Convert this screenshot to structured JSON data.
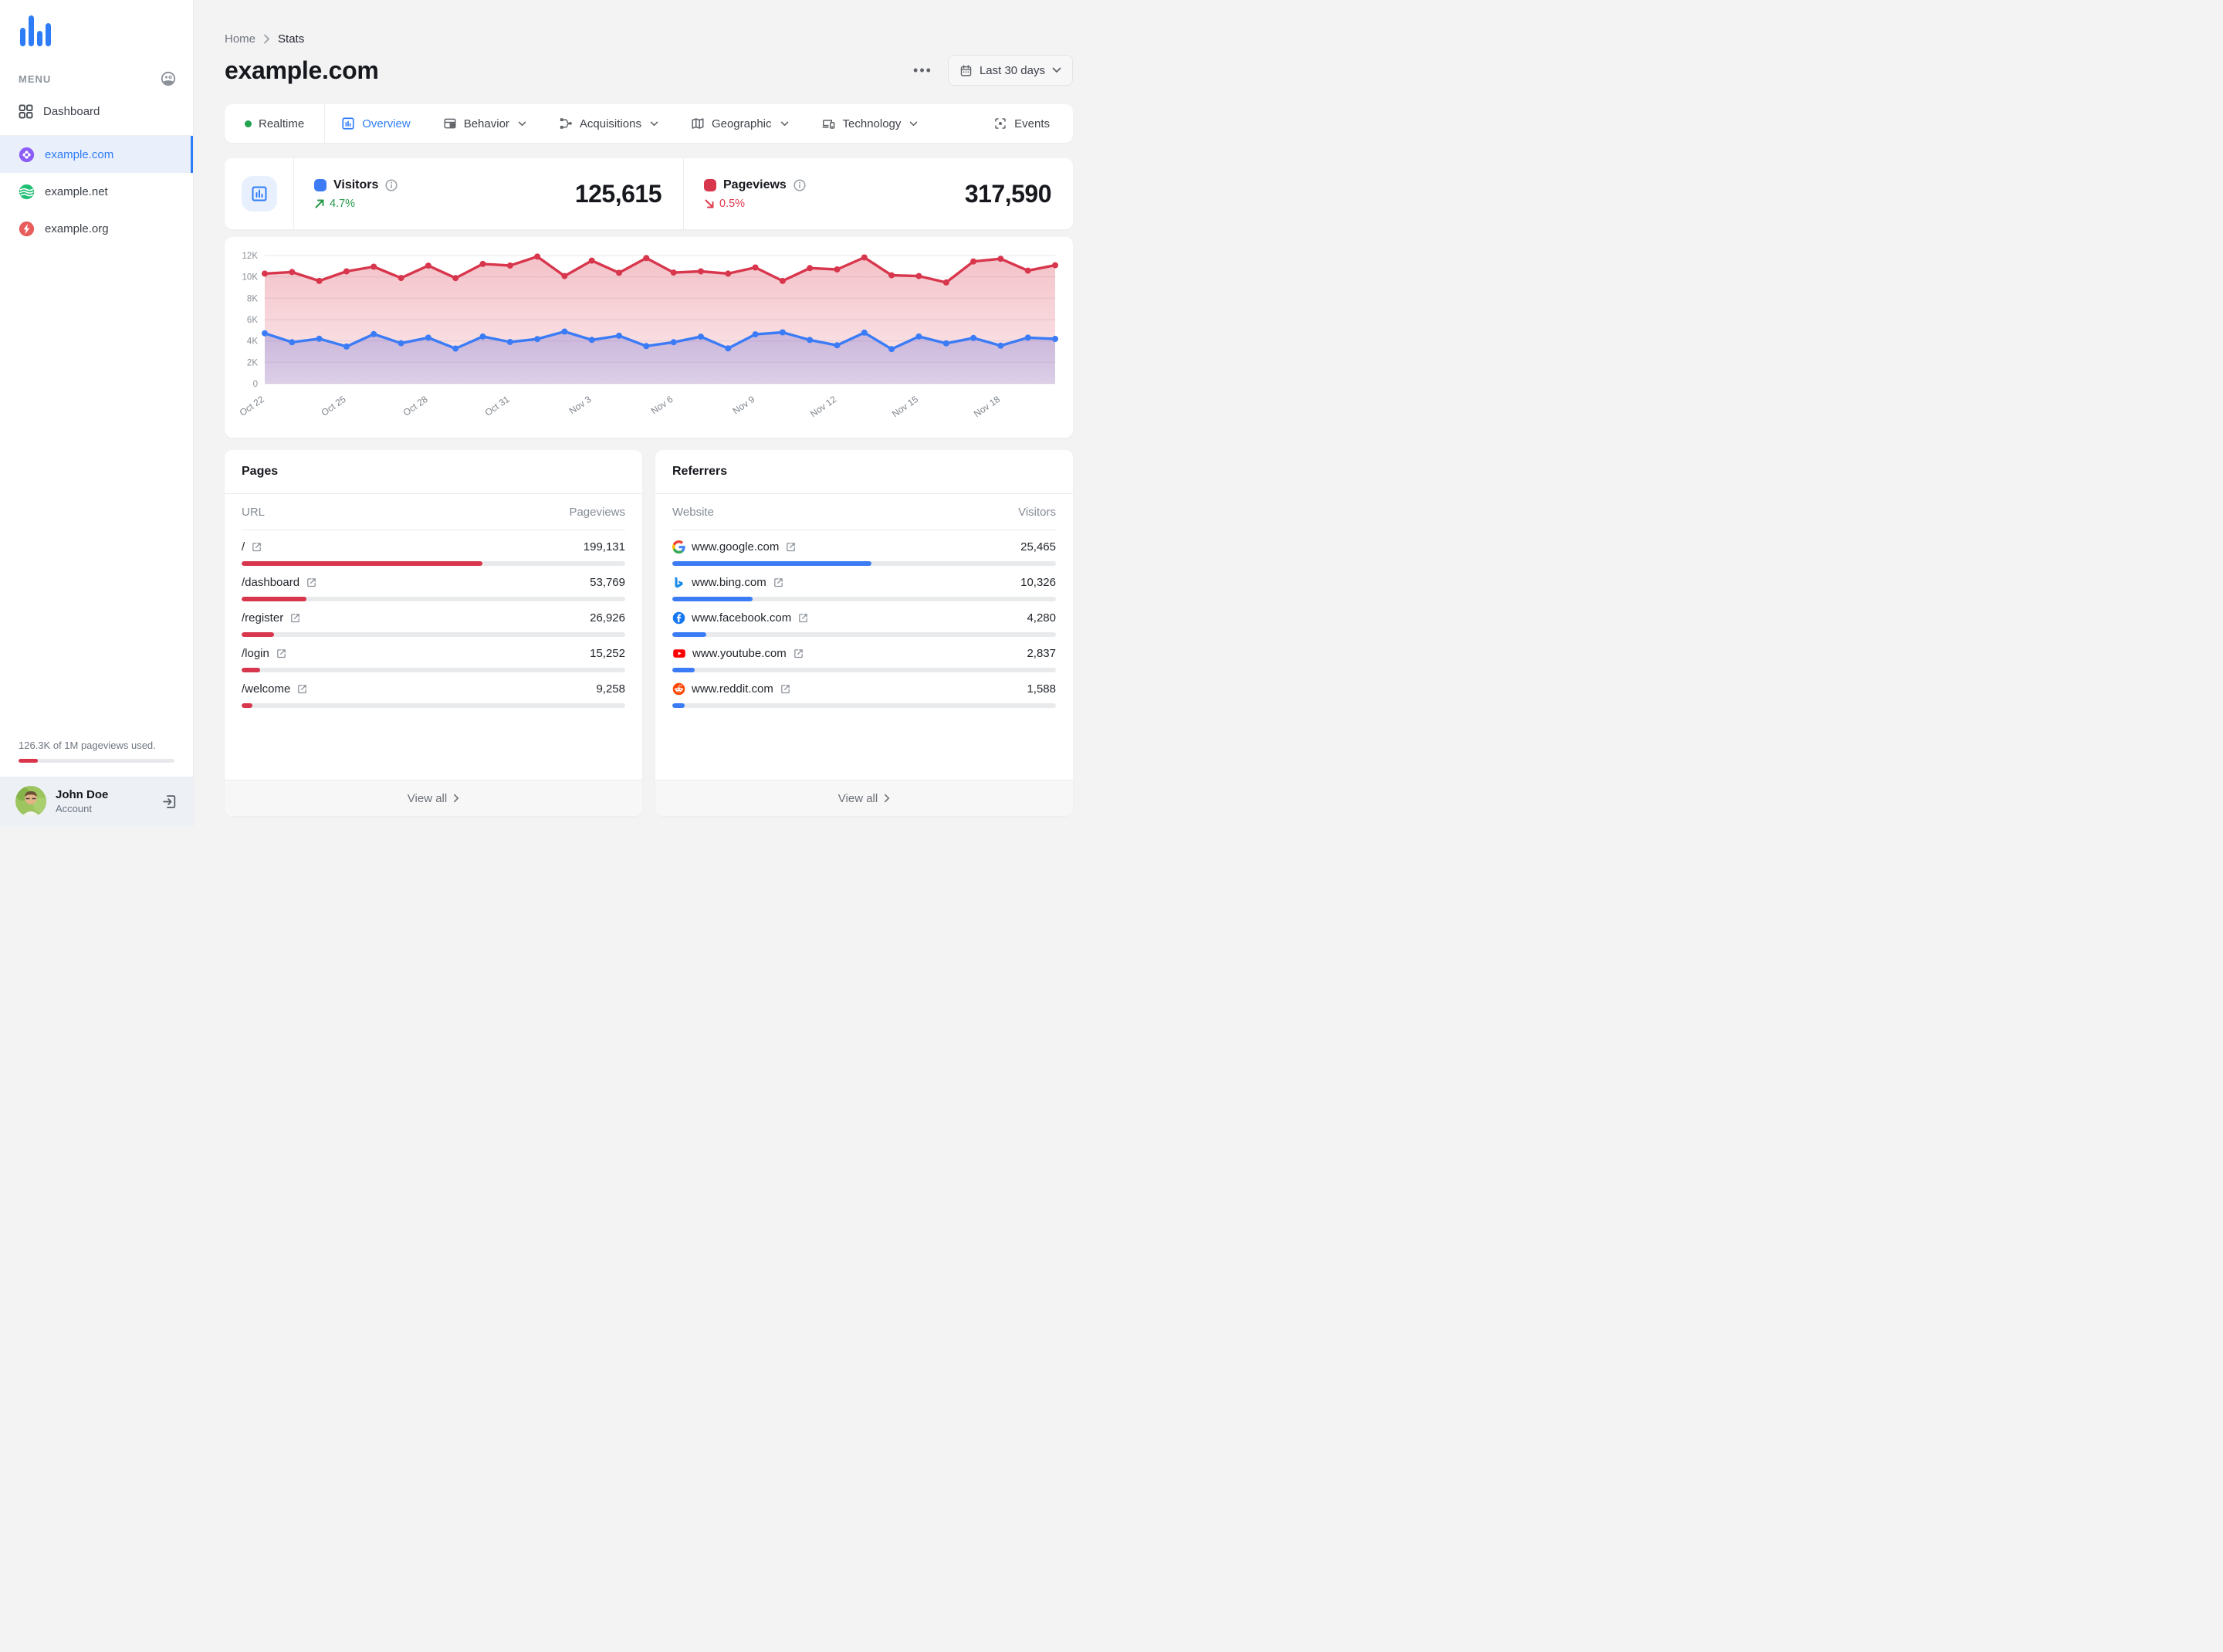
{
  "sidebar": {
    "menu_label": "MENU",
    "dashboard_label": "Dashboard",
    "sites": [
      {
        "name": "example.com",
        "icon": "clover",
        "color": "#8b5cf6",
        "active": true
      },
      {
        "name": "example.net",
        "icon": "waves",
        "color": "#1fbf75",
        "active": false
      },
      {
        "name": "example.org",
        "icon": "bolt",
        "color": "#e85c5c",
        "active": false
      }
    ],
    "usage_text": "126.3K of 1M pageviews used.",
    "usage_pct": 12.6,
    "user": {
      "name": "John Doe",
      "role": "Account"
    }
  },
  "header": {
    "breadcrumb": [
      "Home",
      "Stats"
    ],
    "title": "example.com",
    "date_range": "Last 30 days"
  },
  "tabs": [
    {
      "label": "Realtime"
    },
    {
      "label": "Overview",
      "active": true
    },
    {
      "label": "Behavior",
      "dropdown": true
    },
    {
      "label": "Acquisitions",
      "dropdown": true
    },
    {
      "label": "Geographic",
      "dropdown": true
    },
    {
      "label": "Technology",
      "dropdown": true
    },
    {
      "label": "Events"
    }
  ],
  "stats": {
    "visitors": {
      "label": "Visitors",
      "value": "125,615",
      "change": "4.7%",
      "direction": "up",
      "color": "#3b7cf6"
    },
    "pageviews": {
      "label": "Pageviews",
      "value": "317,590",
      "change": "0.5%",
      "direction": "down",
      "color": "#d8364c"
    }
  },
  "chart_data": {
    "type": "line",
    "x": [
      "Oct 22",
      "Oct 23",
      "Oct 24",
      "Oct 25",
      "Oct 26",
      "Oct 27",
      "Oct 28",
      "Oct 29",
      "Oct 30",
      "Oct 31",
      "Nov 1",
      "Nov 2",
      "Nov 3",
      "Nov 4",
      "Nov 5",
      "Nov 6",
      "Nov 7",
      "Nov 8",
      "Nov 9",
      "Nov 10",
      "Nov 11",
      "Nov 12",
      "Nov 13",
      "Nov 14",
      "Nov 15",
      "Nov 16",
      "Nov 17",
      "Nov 18",
      "Nov 19",
      "Nov 20"
    ],
    "tick_every": 3,
    "ylim": [
      0,
      12000
    ],
    "yticks": [
      "0",
      "2K",
      "4K",
      "6K",
      "8K",
      "10K",
      "12K"
    ],
    "grid": true,
    "legend_position": "none",
    "series": [
      {
        "name": "Visitors",
        "color": "#3b7cf6",
        "values": [
          4720,
          3880,
          4210,
          3480,
          4640,
          3790,
          4310,
          3290,
          4420,
          3900,
          4180,
          4880,
          4100,
          4490,
          3520,
          3880,
          4400,
          3300,
          4620,
          4810,
          4090,
          3590,
          4780,
          3240,
          4420,
          3770,
          4280,
          3560,
          4310,
          4190
        ]
      },
      {
        "name": "Pageviews",
        "color": "#d8364c",
        "values": [
          10310,
          10450,
          9620,
          10520,
          10950,
          9900,
          11050,
          9890,
          11210,
          11060,
          11900,
          10080,
          11520,
          10380,
          11760,
          10400,
          10520,
          10310,
          10880,
          9620,
          10820,
          10700,
          11820,
          10150,
          10080,
          9480,
          11440,
          11700,
          10580,
          11090
        ]
      }
    ]
  },
  "pages": {
    "title": "Pages",
    "col_label": "URL",
    "col_value": "Pageviews",
    "view_all": "View all",
    "rows": [
      {
        "url": "/",
        "value": "199,131",
        "pct": 62.7
      },
      {
        "url": "/dashboard",
        "value": "53,769",
        "pct": 16.9
      },
      {
        "url": "/register",
        "value": "26,926",
        "pct": 8.5
      },
      {
        "url": "/login",
        "value": "15,252",
        "pct": 4.8
      },
      {
        "url": "/welcome",
        "value": "9,258",
        "pct": 2.9
      }
    ]
  },
  "referrers": {
    "title": "Referrers",
    "col_label": "Website",
    "col_value": "Visitors",
    "view_all": "View all",
    "rows": [
      {
        "site": "www.google.com",
        "icon": "google",
        "value": "25,465",
        "pct": 52.0
      },
      {
        "site": "www.bing.com",
        "icon": "bing",
        "value": "10,326",
        "pct": 21.0
      },
      {
        "site": "www.facebook.com",
        "icon": "facebook",
        "value": "4,280",
        "pct": 8.8
      },
      {
        "site": "www.youtube.com",
        "icon": "youtube",
        "value": "2,837",
        "pct": 5.8
      },
      {
        "site": "www.reddit.com",
        "icon": "reddit",
        "value": "1,588",
        "pct": 3.3
      }
    ]
  }
}
